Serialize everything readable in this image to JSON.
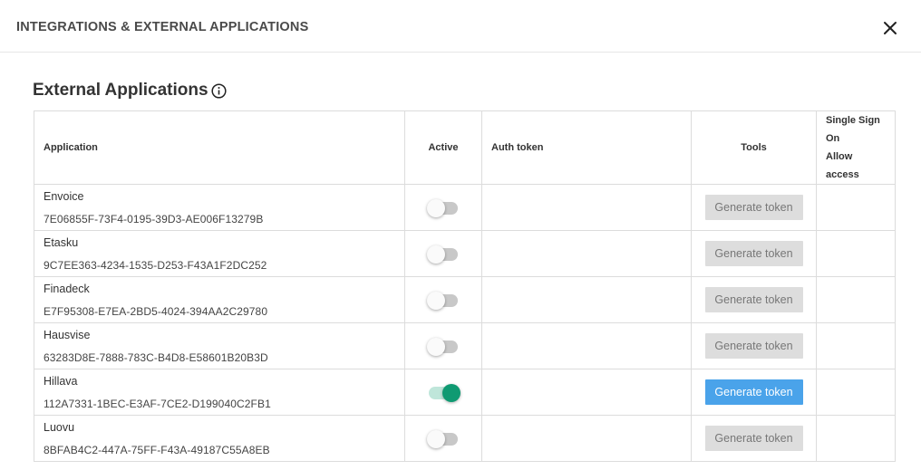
{
  "modal": {
    "title": "INTEGRATIONS & EXTERNAL APPLICATIONS",
    "close_icon": "close-icon"
  },
  "section": {
    "title": "External Applications",
    "info_icon": "info-icon"
  },
  "table": {
    "headers": {
      "application": "Application",
      "active": "Active",
      "auth_token": "Auth token",
      "tools": "Tools",
      "sso_line1": "Single Sign On",
      "sso_line2": "Allow access"
    },
    "rows": [
      {
        "name": "Envoice",
        "id": "7E06855F-73F4-0195-39D3-AE006F13279B",
        "active": false,
        "button": "Generate token"
      },
      {
        "name": "Etasku",
        "id": "9C7EE363-4234-1535-D253-F43A1F2DC252",
        "active": false,
        "button": "Generate token"
      },
      {
        "name": "Finadeck",
        "id": "E7F95308-E7EA-2BD5-4024-394AA2C29780",
        "active": false,
        "button": "Generate token"
      },
      {
        "name": "Hausvise",
        "id": "63283D8E-7888-783C-B4D8-E58601B20B3D",
        "active": false,
        "button": "Generate token"
      },
      {
        "name": "Hillava",
        "id": "112A7331-1BEC-E3AF-7CE2-D199040C2FB1",
        "active": true,
        "button": "Generate token"
      },
      {
        "name": "Luovu",
        "id": "8BFAB4C2-447A-75FF-F43A-49187C55A8EB",
        "active": false,
        "button": "Generate token"
      }
    ]
  },
  "colors": {
    "toggle_on": "#0f9a72",
    "toggle_on_track": "#bfe6da",
    "button_active": "#4aa3ea",
    "button_disabled": "#dddddd"
  }
}
